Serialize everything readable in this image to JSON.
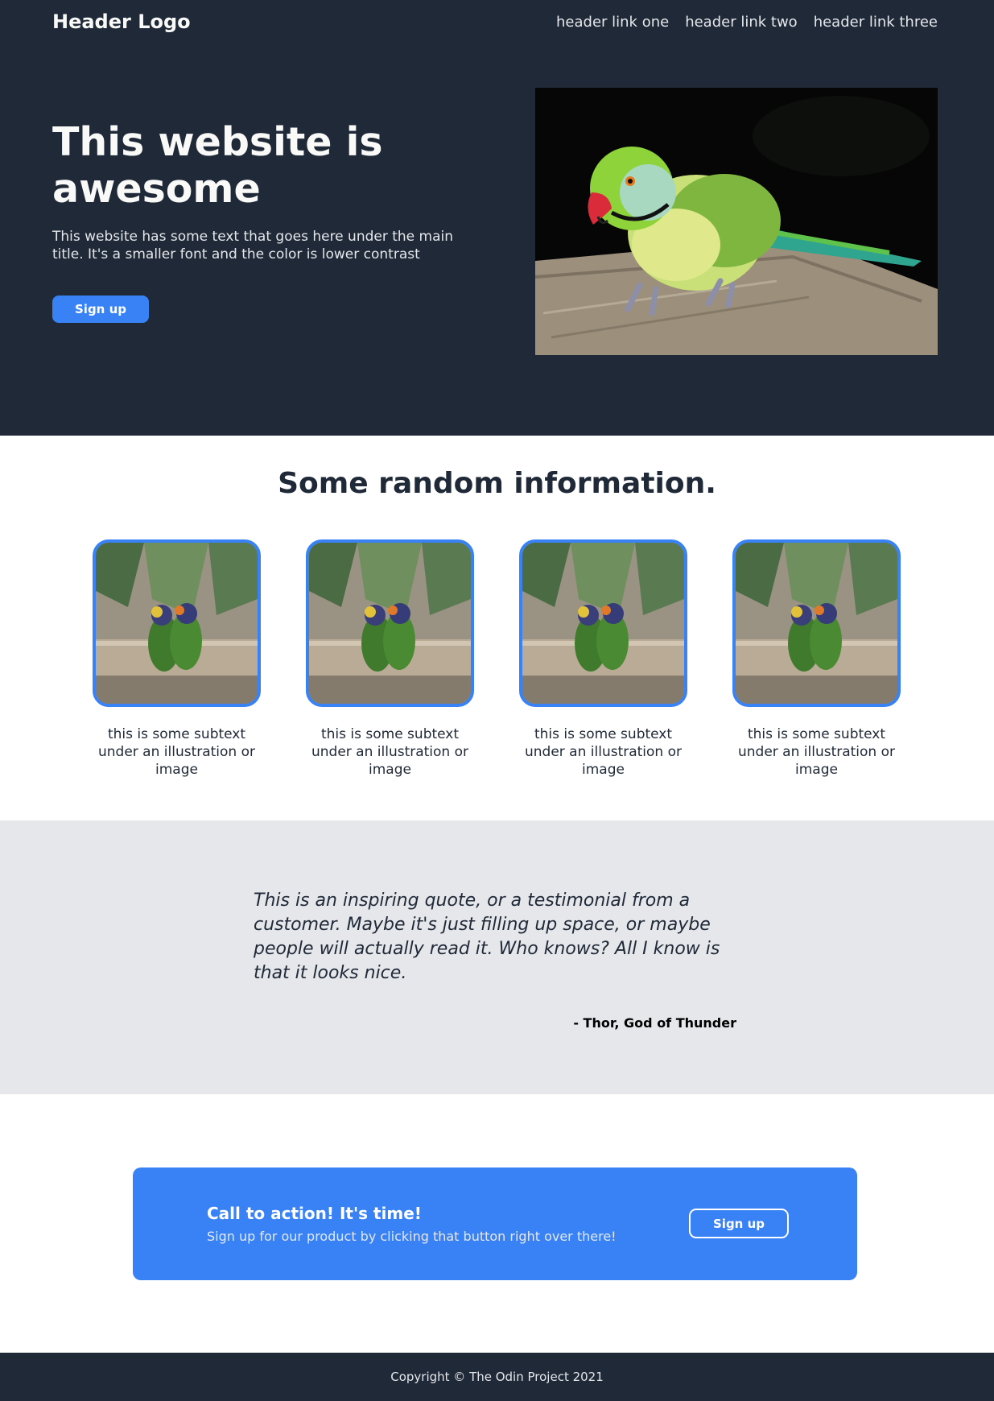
{
  "header": {
    "logo": "Header Logo",
    "links": [
      "header link one",
      "header link two",
      "header link three"
    ]
  },
  "hero": {
    "title": "This website is awesome",
    "text": "This website has some text that goes here under the main title. It's a smaller font and the color is lower contrast",
    "button": "Sign up",
    "image_icon": "parrot-image"
  },
  "info": {
    "title": "Some random information.",
    "cards": [
      {
        "text": "this is some subtext under an illustration or image"
      },
      {
        "text": "this is some subtext under an illustration or image"
      },
      {
        "text": "this is some subtext under an illustration or image"
      },
      {
        "text": "this is some subtext under an illustration or image"
      }
    ]
  },
  "quote": {
    "text": "This is an inspiring quote, or a testimonial from a customer. Maybe it's just filling up space, or maybe people will actually read it. Who knows? All I know is that it looks nice.",
    "author": "- Thor, God of Thunder"
  },
  "cta": {
    "title": "Call to action! It's time!",
    "text": "Sign up for our product by clicking that button right over there!",
    "button": "Sign up"
  },
  "footer": {
    "text": "Copyright © The Odin Project 2021"
  },
  "colors": {
    "dark": "#1f2937",
    "accent": "#3882f6",
    "light_gray": "#e5e7eb"
  }
}
